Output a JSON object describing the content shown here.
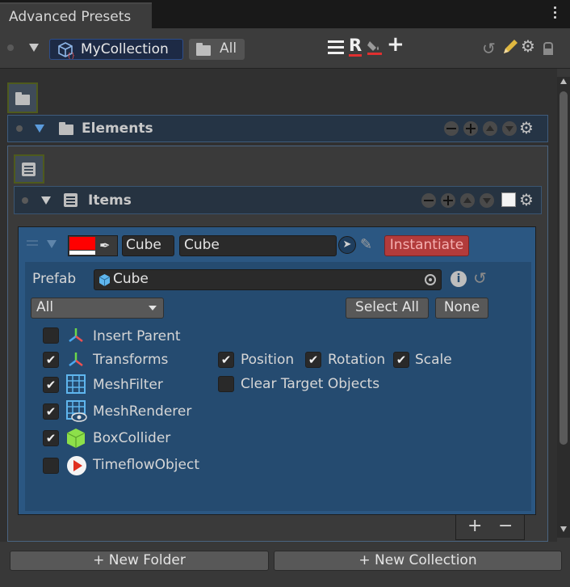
{
  "window": {
    "tab_title": "Advanced Presets"
  },
  "toolbar": {
    "collection_label": "MyCollection",
    "folder_label": "All",
    "reset_letter": "R",
    "add_symbol": "+"
  },
  "elements": {
    "label": "Elements"
  },
  "items": {
    "label": "Items"
  },
  "item": {
    "color_hex": "#ff0000",
    "short_name": "Cube",
    "name": "Cube",
    "instantiate_label": "Instantiate",
    "prefab_label": "Prefab",
    "prefab_value": "Cube",
    "filter_selected": "All",
    "select_all_label": "Select All",
    "none_label": "None"
  },
  "components": [
    {
      "label": "Insert Parent",
      "icon": "transform-axes-icon",
      "checked": false
    },
    {
      "label": "Transforms",
      "icon": "transform-axes-icon",
      "checked": true
    },
    {
      "label": "MeshFilter",
      "icon": "mesh-grid-icon",
      "checked": true
    },
    {
      "label": "MeshRenderer",
      "icon": "mesh-renderer-icon",
      "checked": true
    },
    {
      "label": "BoxCollider",
      "icon": "box-collider-icon",
      "checked": true
    },
    {
      "label": "TimeflowObject",
      "icon": "timeflow-play-icon",
      "checked": false
    }
  ],
  "transform_options": {
    "position": "Position",
    "rotation": "Rotation",
    "scale": "Scale",
    "clear_target": "Clear Target Objects"
  },
  "list_footer": {
    "add": "+",
    "remove": "−"
  },
  "bottom": {
    "new_folder": "+ New Folder",
    "new_collection": "+ New Collection"
  },
  "colors": {
    "accent_blue": "#2b5782",
    "instantiate_red": "#e06666",
    "header_blue": "#253445"
  }
}
